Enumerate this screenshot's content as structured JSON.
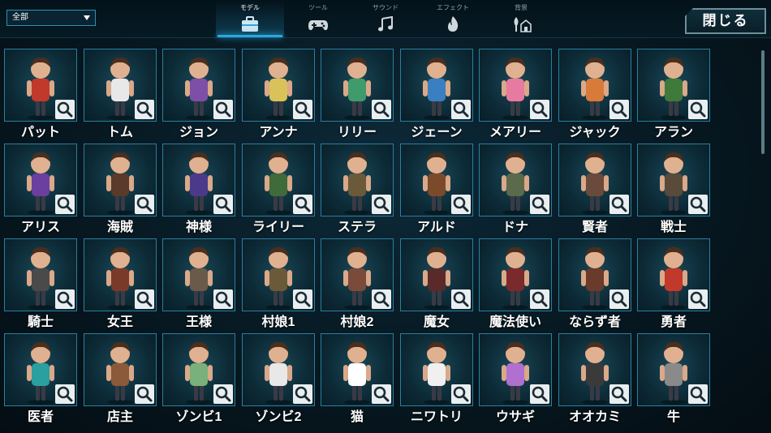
{
  "filter": {
    "value": "全部"
  },
  "tabs": [
    {
      "label": "モデル",
      "icon": "briefcase-icon",
      "active": true
    },
    {
      "label": "ツール",
      "icon": "gamepad-icon",
      "active": false
    },
    {
      "label": "サウンド",
      "icon": "music-note-icon",
      "active": false
    },
    {
      "label": "エフェクト",
      "icon": "flame-icon",
      "active": false
    },
    {
      "label": "背景",
      "icon": "tree-house-icon",
      "active": false
    }
  ],
  "close_label": "閉じる",
  "colors": {
    "accent": "#2aa8e0",
    "border": "#2a7fa0",
    "background": "#071821"
  },
  "characters": [
    {
      "name": "パット",
      "color": "#c0392b"
    },
    {
      "name": "トム",
      "color": "#e8e8e8"
    },
    {
      "name": "ジョン",
      "color": "#7d4fa6"
    },
    {
      "name": "アンナ",
      "color": "#d9c25a"
    },
    {
      "name": "リリー",
      "color": "#3f9b6b"
    },
    {
      "name": "ジェーン",
      "color": "#3a7fc1"
    },
    {
      "name": "メアリー",
      "color": "#e67aa0"
    },
    {
      "name": "ジャック",
      "color": "#d87b3a"
    },
    {
      "name": "アラン",
      "color": "#3e7a3a"
    },
    {
      "name": "アリス",
      "color": "#6a3fa0"
    },
    {
      "name": "海賊",
      "color": "#5a3a2a"
    },
    {
      "name": "神様",
      "color": "#4b3a8a"
    },
    {
      "name": "ライリー",
      "color": "#3f6a3a"
    },
    {
      "name": "ステラ",
      "color": "#6a5a3a"
    },
    {
      "name": "アルド",
      "color": "#7a4a2a"
    },
    {
      "name": "ドナ",
      "color": "#5a6a4a"
    },
    {
      "name": "賢者",
      "color": "#6a4a3a"
    },
    {
      "name": "戦士",
      "color": "#5a4a3a"
    },
    {
      "name": "騎士",
      "color": "#4a4a4a"
    },
    {
      "name": "女王",
      "color": "#7a3a2a"
    },
    {
      "name": "王様",
      "color": "#6a5a4a"
    },
    {
      "name": "村娘1",
      "color": "#6a5a3a"
    },
    {
      "name": "村娘2",
      "color": "#7a4a3a"
    },
    {
      "name": "魔女",
      "color": "#5a2a2a"
    },
    {
      "name": "魔法使い",
      "color": "#7a2a2a"
    },
    {
      "name": "ならず者",
      "color": "#6a3a2a"
    },
    {
      "name": "勇者",
      "color": "#c0392b"
    },
    {
      "name": "医者",
      "color": "#2aa0a0"
    },
    {
      "name": "店主",
      "color": "#8a5a3a"
    },
    {
      "name": "ゾンビ1",
      "color": "#7ab07a"
    },
    {
      "name": "ゾンビ2",
      "color": "#e8e8e8"
    },
    {
      "name": "猫",
      "color": "#ffffff"
    },
    {
      "name": "ニワトリ",
      "color": "#f0f0f0"
    },
    {
      "name": "ウサギ",
      "color": "#b070d0"
    },
    {
      "name": "オオカミ",
      "color": "#3a3a3a"
    },
    {
      "name": "牛",
      "color": "#8a8a8a"
    }
  ]
}
